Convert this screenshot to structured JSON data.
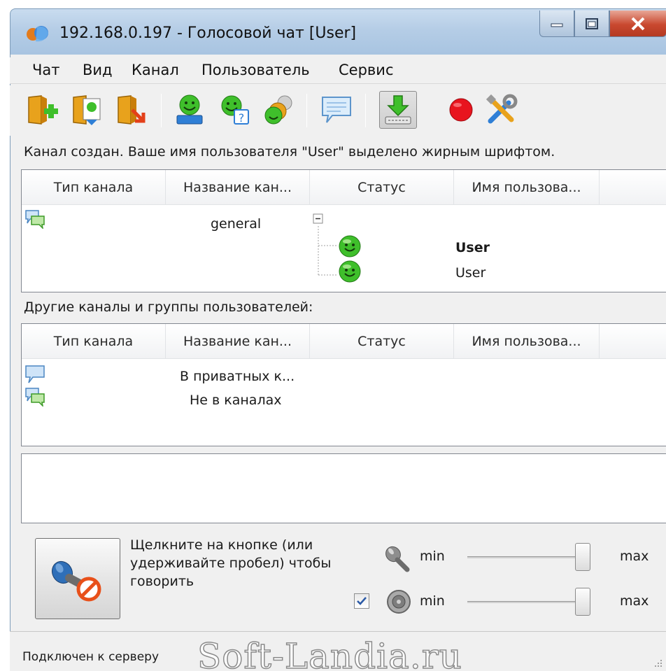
{
  "window": {
    "title": "192.168.0.197 - Голосовой чат [User]"
  },
  "menu": {
    "items": [
      "Чат",
      "Вид",
      "Канал",
      "Пользователь",
      "Сервис"
    ]
  },
  "toolbar": {
    "icons": [
      "join-channel-icon",
      "channel-users-icon",
      "leave-channel-icon",
      "user-info-icon",
      "user-help-icon",
      "users-group-icon",
      "message-icon",
      "push-to-talk-icon",
      "record-icon",
      "settings-tools-icon"
    ]
  },
  "info": {
    "message": "Канал создан. Ваше имя пользователя \"User\" выделено жирным шрифтом."
  },
  "list1": {
    "columns": [
      "Тип канала",
      "Название кан...",
      "Статус",
      "Имя пользова..."
    ],
    "channel_name": "general",
    "users": [
      {
        "name": "User",
        "bold": true
      },
      {
        "name": "User",
        "bold": false
      }
    ]
  },
  "other_label": "Другие каналы и группы пользователей:",
  "list2": {
    "columns": [
      "Тип канала",
      "Название кан...",
      "Статус",
      "Имя пользова..."
    ],
    "rows": [
      "В приватных к...",
      "Не в каналах"
    ]
  },
  "controls": {
    "hint": "Щелкните на кнопке (или удерживайте пробел) чтобы говорить",
    "mic_min": "min",
    "mic_max": "max",
    "speaker_min": "min",
    "speaker_max": "max",
    "mic_level": 0.98,
    "speaker_level": 0.98,
    "speaker_enabled": true
  },
  "status": {
    "text": "Подключен к серверу",
    "watermark": "Soft-Landia.ru"
  },
  "colors": {
    "titlebar": "#b5cde6",
    "close_button": "#c9482f",
    "record": "#e8141e",
    "smiley": "#3fbf2b"
  }
}
